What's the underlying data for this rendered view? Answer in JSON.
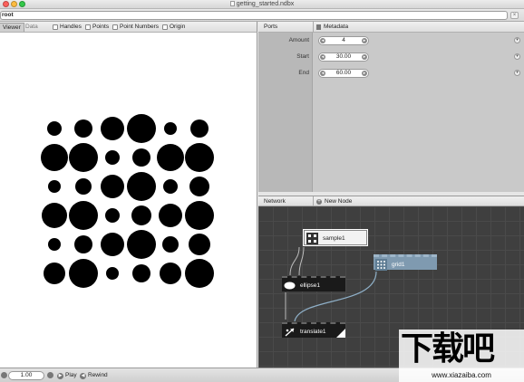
{
  "window": {
    "title": "getting_started.ndbx",
    "traffic_colors": [
      "#fc605b",
      "#fdbc40",
      "#34c84a"
    ]
  },
  "addressbar": {
    "path": "root",
    "close": "×"
  },
  "viewer": {
    "tabs": [
      {
        "label": "Viewer",
        "active": true
      },
      {
        "label": "Data",
        "active": false
      }
    ],
    "options": [
      "Handles",
      "Points",
      "Point Numbers",
      "Origin"
    ],
    "dot_grid": {
      "columns": 6,
      "rows": 6,
      "diameters": [
        [
          16,
          20,
          26,
          32,
          14,
          20
        ],
        [
          30,
          32,
          16,
          20,
          30,
          32
        ],
        [
          14,
          18,
          26,
          32,
          16,
          22
        ],
        [
          28,
          32,
          16,
          22,
          26,
          32
        ],
        [
          14,
          20,
          26,
          32,
          18,
          24
        ],
        [
          24,
          32,
          14,
          20,
          24,
          32
        ]
      ]
    }
  },
  "ports": {
    "header": "Ports",
    "metadata_label": "Metadata",
    "rows": [
      {
        "name": "Amount",
        "value": "4"
      },
      {
        "name": "Start",
        "value": "30.00"
      },
      {
        "name": "End",
        "value": "60.00"
      }
    ]
  },
  "network": {
    "header": "Network",
    "new_node_label": "New Node",
    "nodes": [
      {
        "name": "sample1",
        "kind": "sample",
        "selected": true
      },
      {
        "name": "grid1",
        "kind": "grid",
        "rendered": true
      },
      {
        "name": "ellipse1",
        "kind": "ellipse"
      },
      {
        "name": "translate1",
        "kind": "translate"
      }
    ]
  },
  "bottombar": {
    "frame": "1.00",
    "play_label": "Play",
    "rewind_label": "Rewind"
  },
  "watermark": {
    "text": "下载吧",
    "url": "www.xiazaiba.com"
  }
}
